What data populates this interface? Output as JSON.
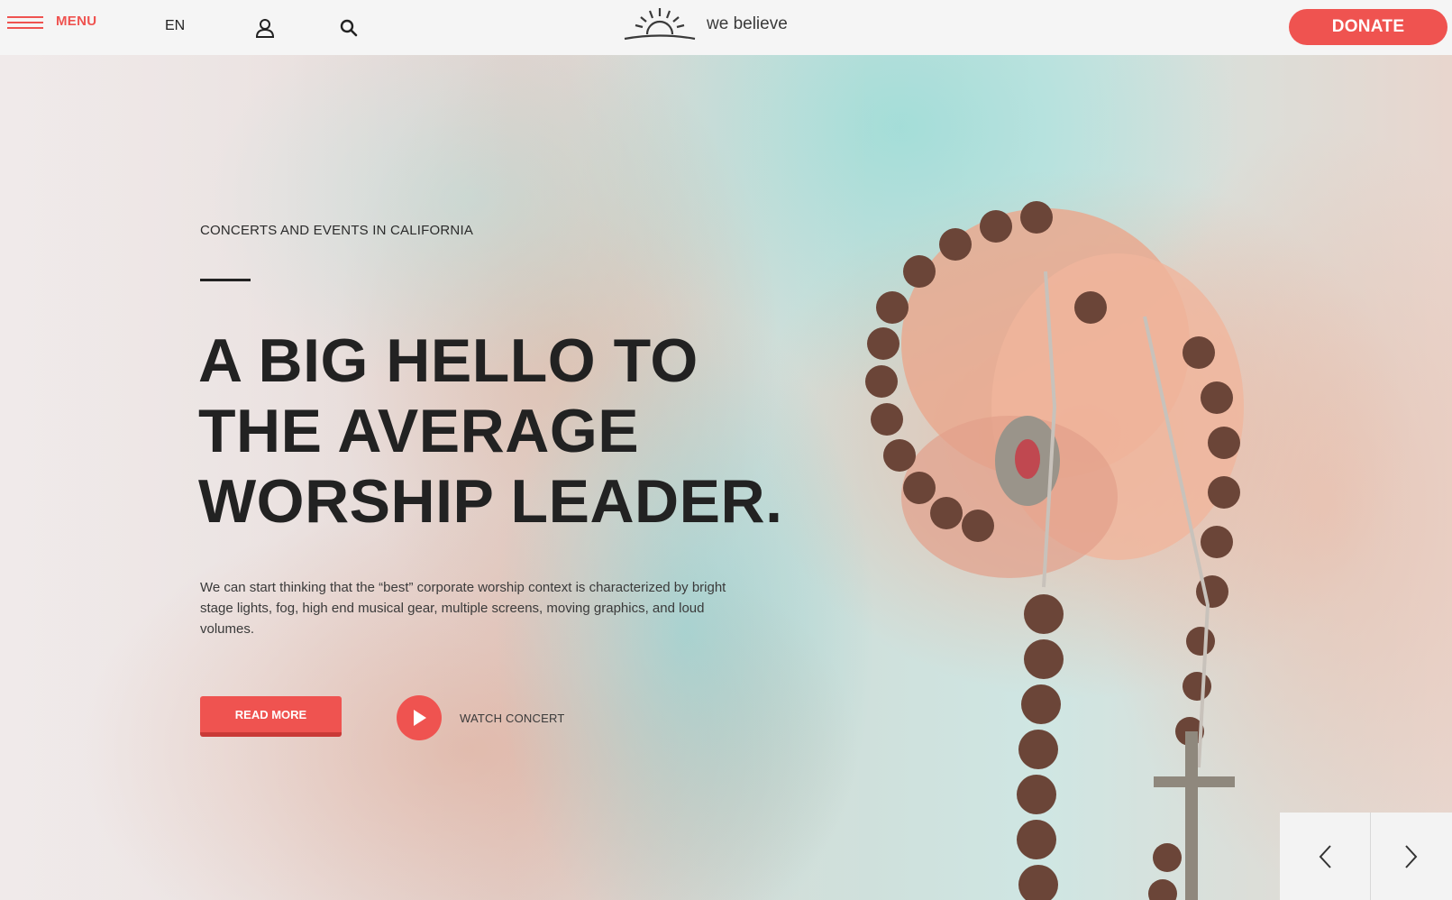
{
  "header": {
    "menu_label": "MENU",
    "language": "EN",
    "logo_text": "we believe",
    "donate_label": "DONATE"
  },
  "icons": {
    "menu": "hamburger-icon",
    "user": "user-icon",
    "search": "search-icon",
    "logo": "sunrise-logo-icon",
    "play": "play-icon",
    "prev": "chevron-left-icon",
    "next": "chevron-right-icon"
  },
  "hero": {
    "eyebrow": "CONCERTS AND EVENTS IN CALIFORNIA",
    "headline_lines": [
      "A BIG HELLO TO",
      "THE AVERAGE",
      "WORSHIP LEADER."
    ],
    "intro": "We can start thinking that the “best” corporate worship context is characterized by bright stage lights, fog, high end musical gear, multiple screens, moving graphics, and loud volumes.",
    "read_more_label": "READ MORE",
    "watch_label": "WATCH CONCERT"
  },
  "colors": {
    "accent": "#ef5350",
    "header_bg": "#f5f5f5",
    "text_dark": "#222222"
  }
}
